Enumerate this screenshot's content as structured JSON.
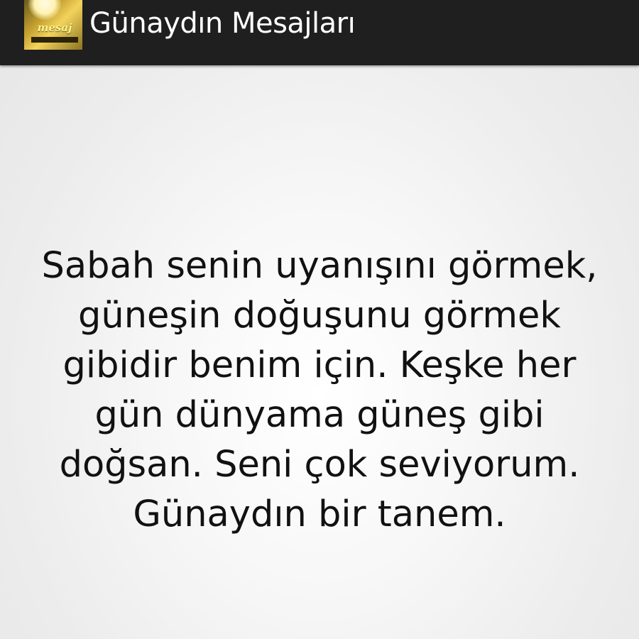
{
  "app_bar": {
    "icon": "app-logo-icon",
    "title": "Günaydın Mesajları",
    "background": "#1f1f1f"
  },
  "message": {
    "text": "Sabah senin uyanışını görmek, güneşin doğuşunu görmek gibidir benim için. Keşke her gün dünyama güneş gibi doğsan. Seni çok seviyorum. Günaydın bir tanem."
  }
}
